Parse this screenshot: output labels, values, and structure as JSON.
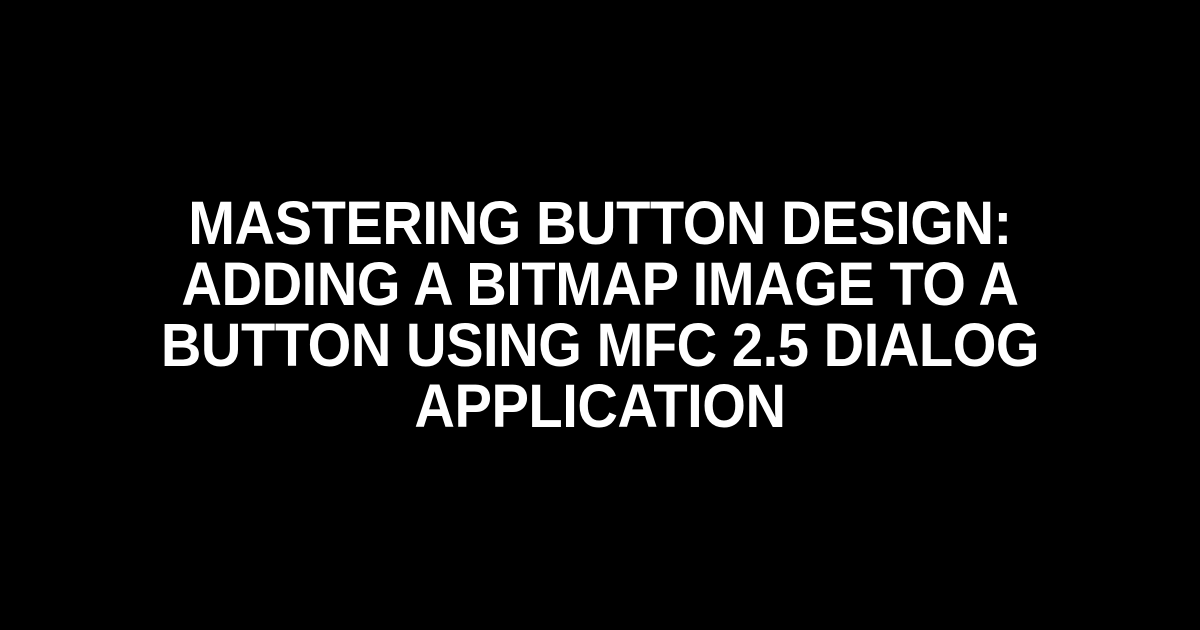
{
  "title": "Mastering Button Design: Adding a Bitmap Image to a Button using MFC 2.5 Dialog Application"
}
